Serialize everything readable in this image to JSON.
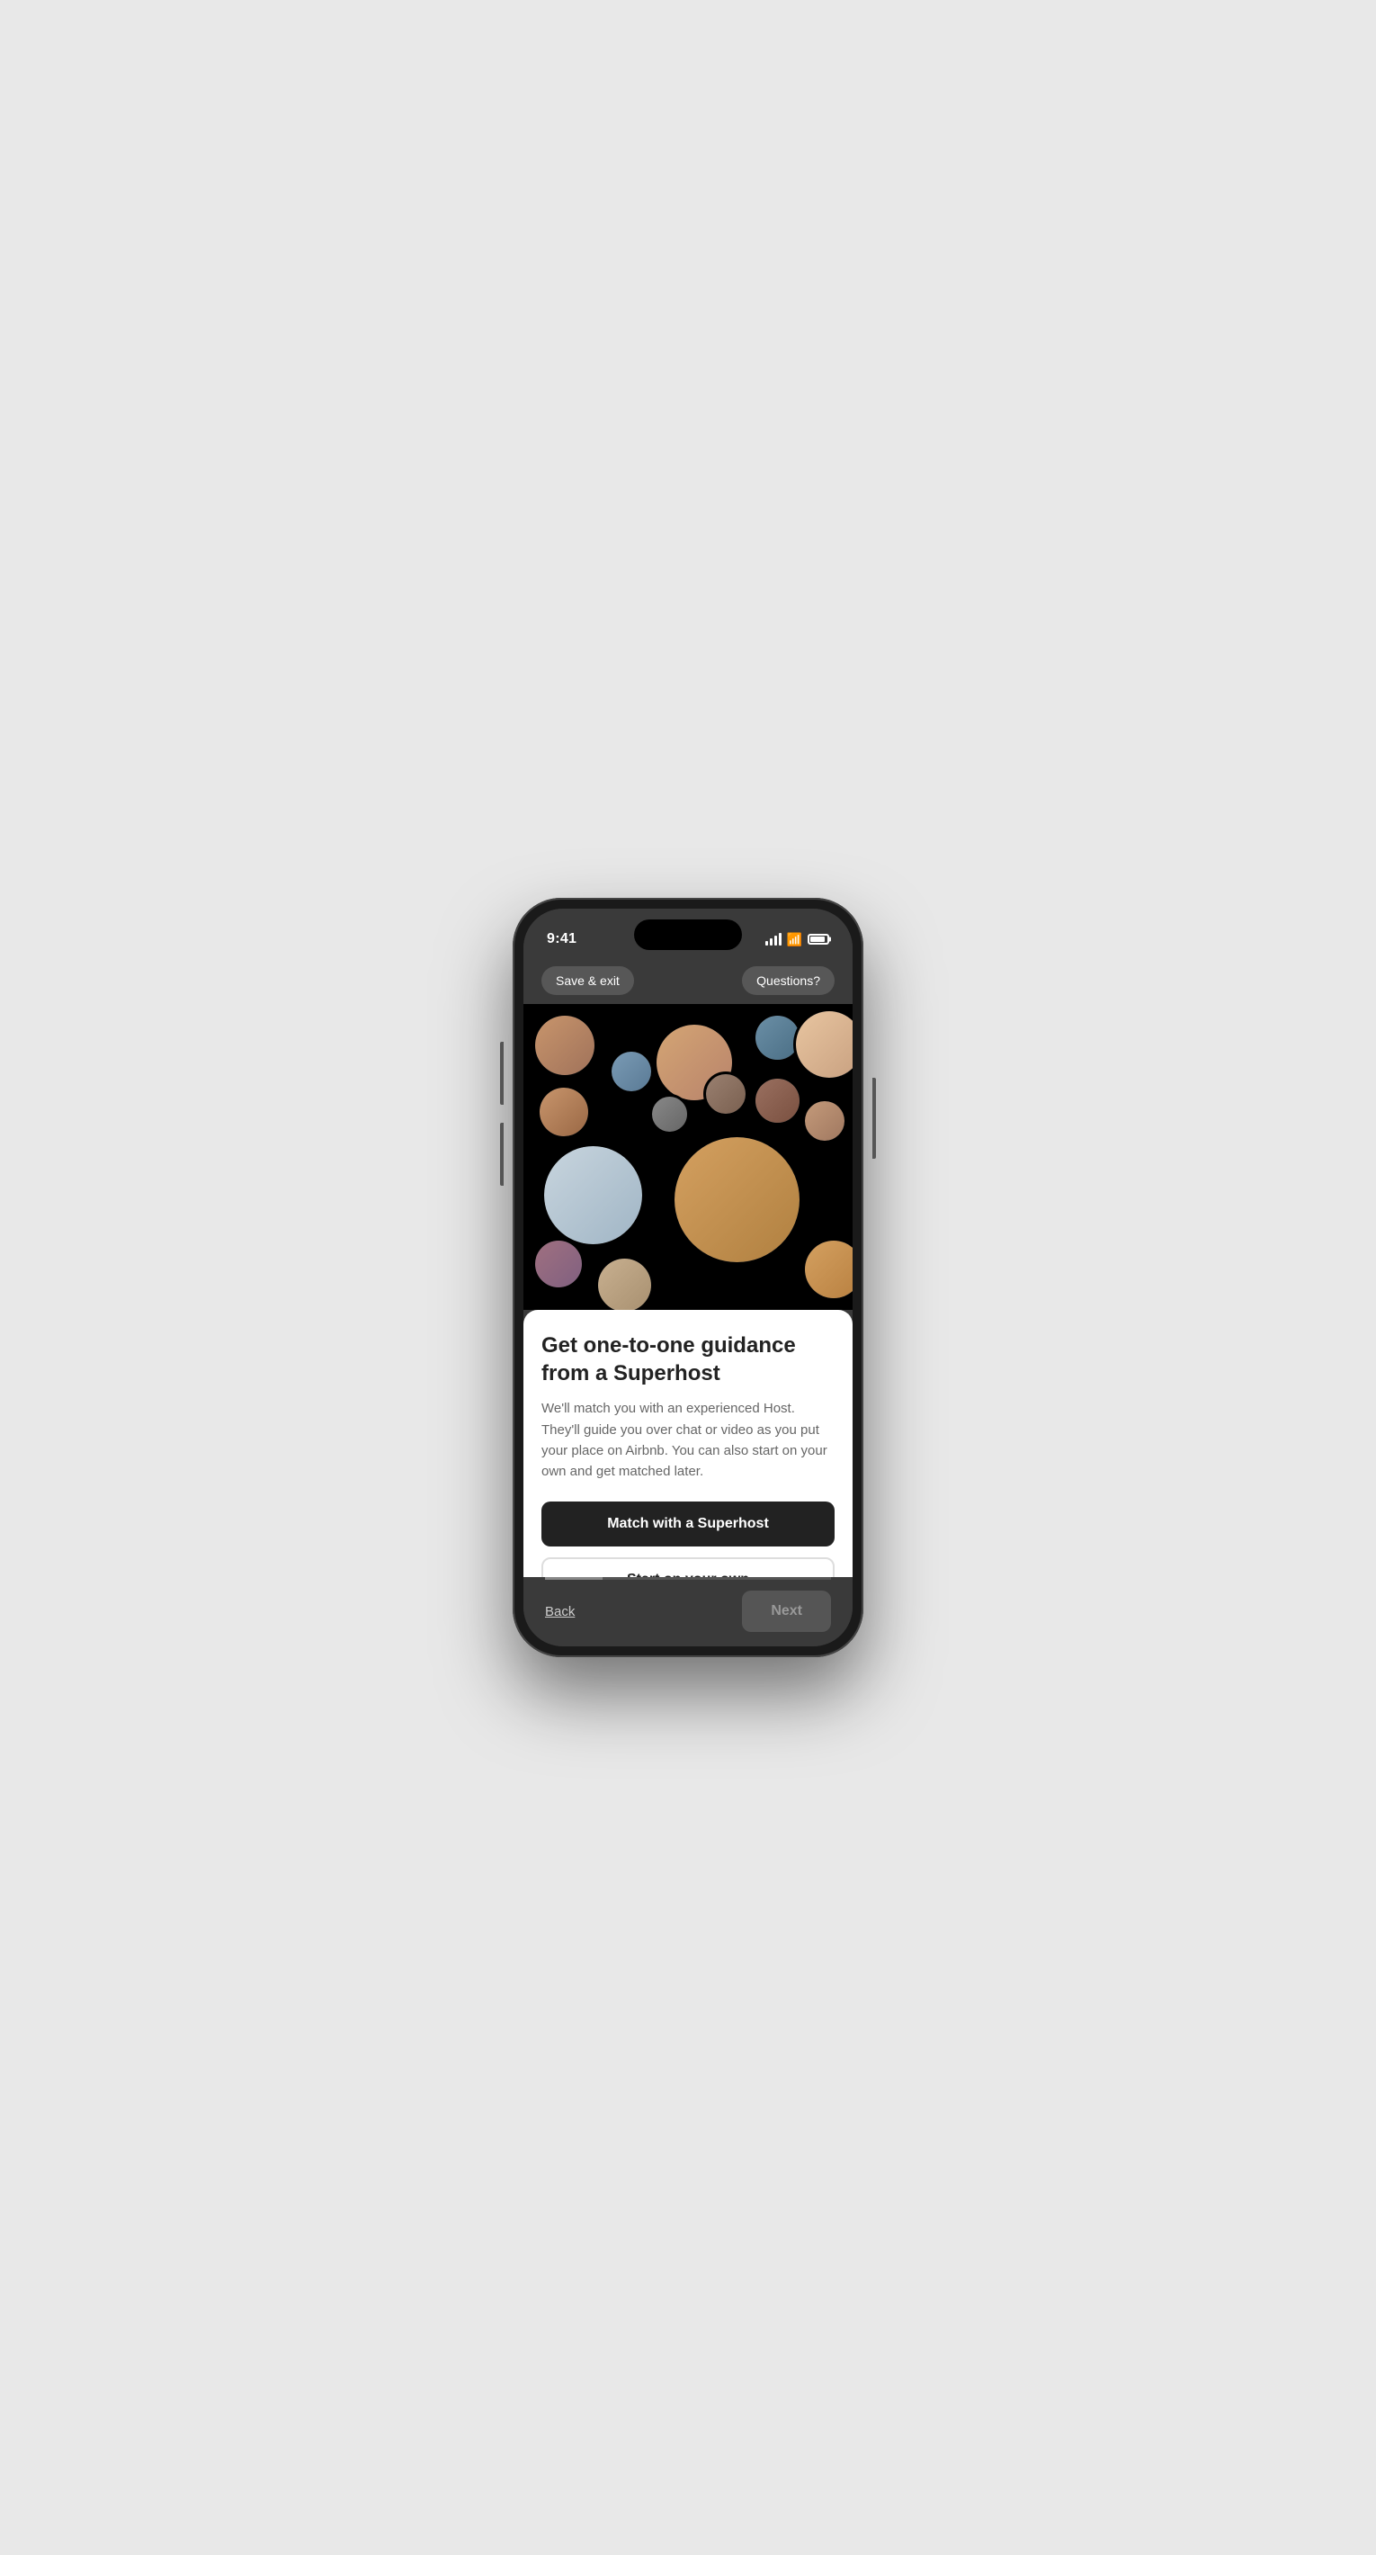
{
  "status_bar": {
    "time": "9:41",
    "signal": "signal-icon",
    "wifi": "wifi-icon",
    "battery": "battery-icon"
  },
  "top_bar": {
    "save_exit_label": "Save & exit",
    "questions_label": "Questions?"
  },
  "hero": {
    "avatars": [
      {
        "id": 1,
        "class": "av1"
      },
      {
        "id": 2,
        "class": "av2"
      },
      {
        "id": 3,
        "class": "av3"
      },
      {
        "id": 4,
        "class": "av4"
      },
      {
        "id": 5,
        "class": "av5"
      },
      {
        "id": 6,
        "class": "av6"
      },
      {
        "id": 7,
        "class": "av7"
      },
      {
        "id": 8,
        "class": "av8"
      },
      {
        "id": 9,
        "class": "av9"
      },
      {
        "id": 10,
        "class": "av10"
      },
      {
        "id": 11,
        "class": "av11"
      },
      {
        "id": 12,
        "class": "av12"
      },
      {
        "id": 13,
        "class": "av13"
      },
      {
        "id": 14,
        "class": "av14"
      },
      {
        "id": 15,
        "class": "av15"
      }
    ]
  },
  "card": {
    "title": "Get one-to-one guidance from a Superhost",
    "description": "We'll match you with an experienced Host. They'll guide you over chat or video as you put your place on Airbnb. You can also start on your own and get matched later.",
    "primary_button_label": "Match with a Superhost",
    "secondary_button_label": "Start on your own"
  },
  "bottom_nav": {
    "back_label": "Back",
    "next_label": "Next"
  }
}
